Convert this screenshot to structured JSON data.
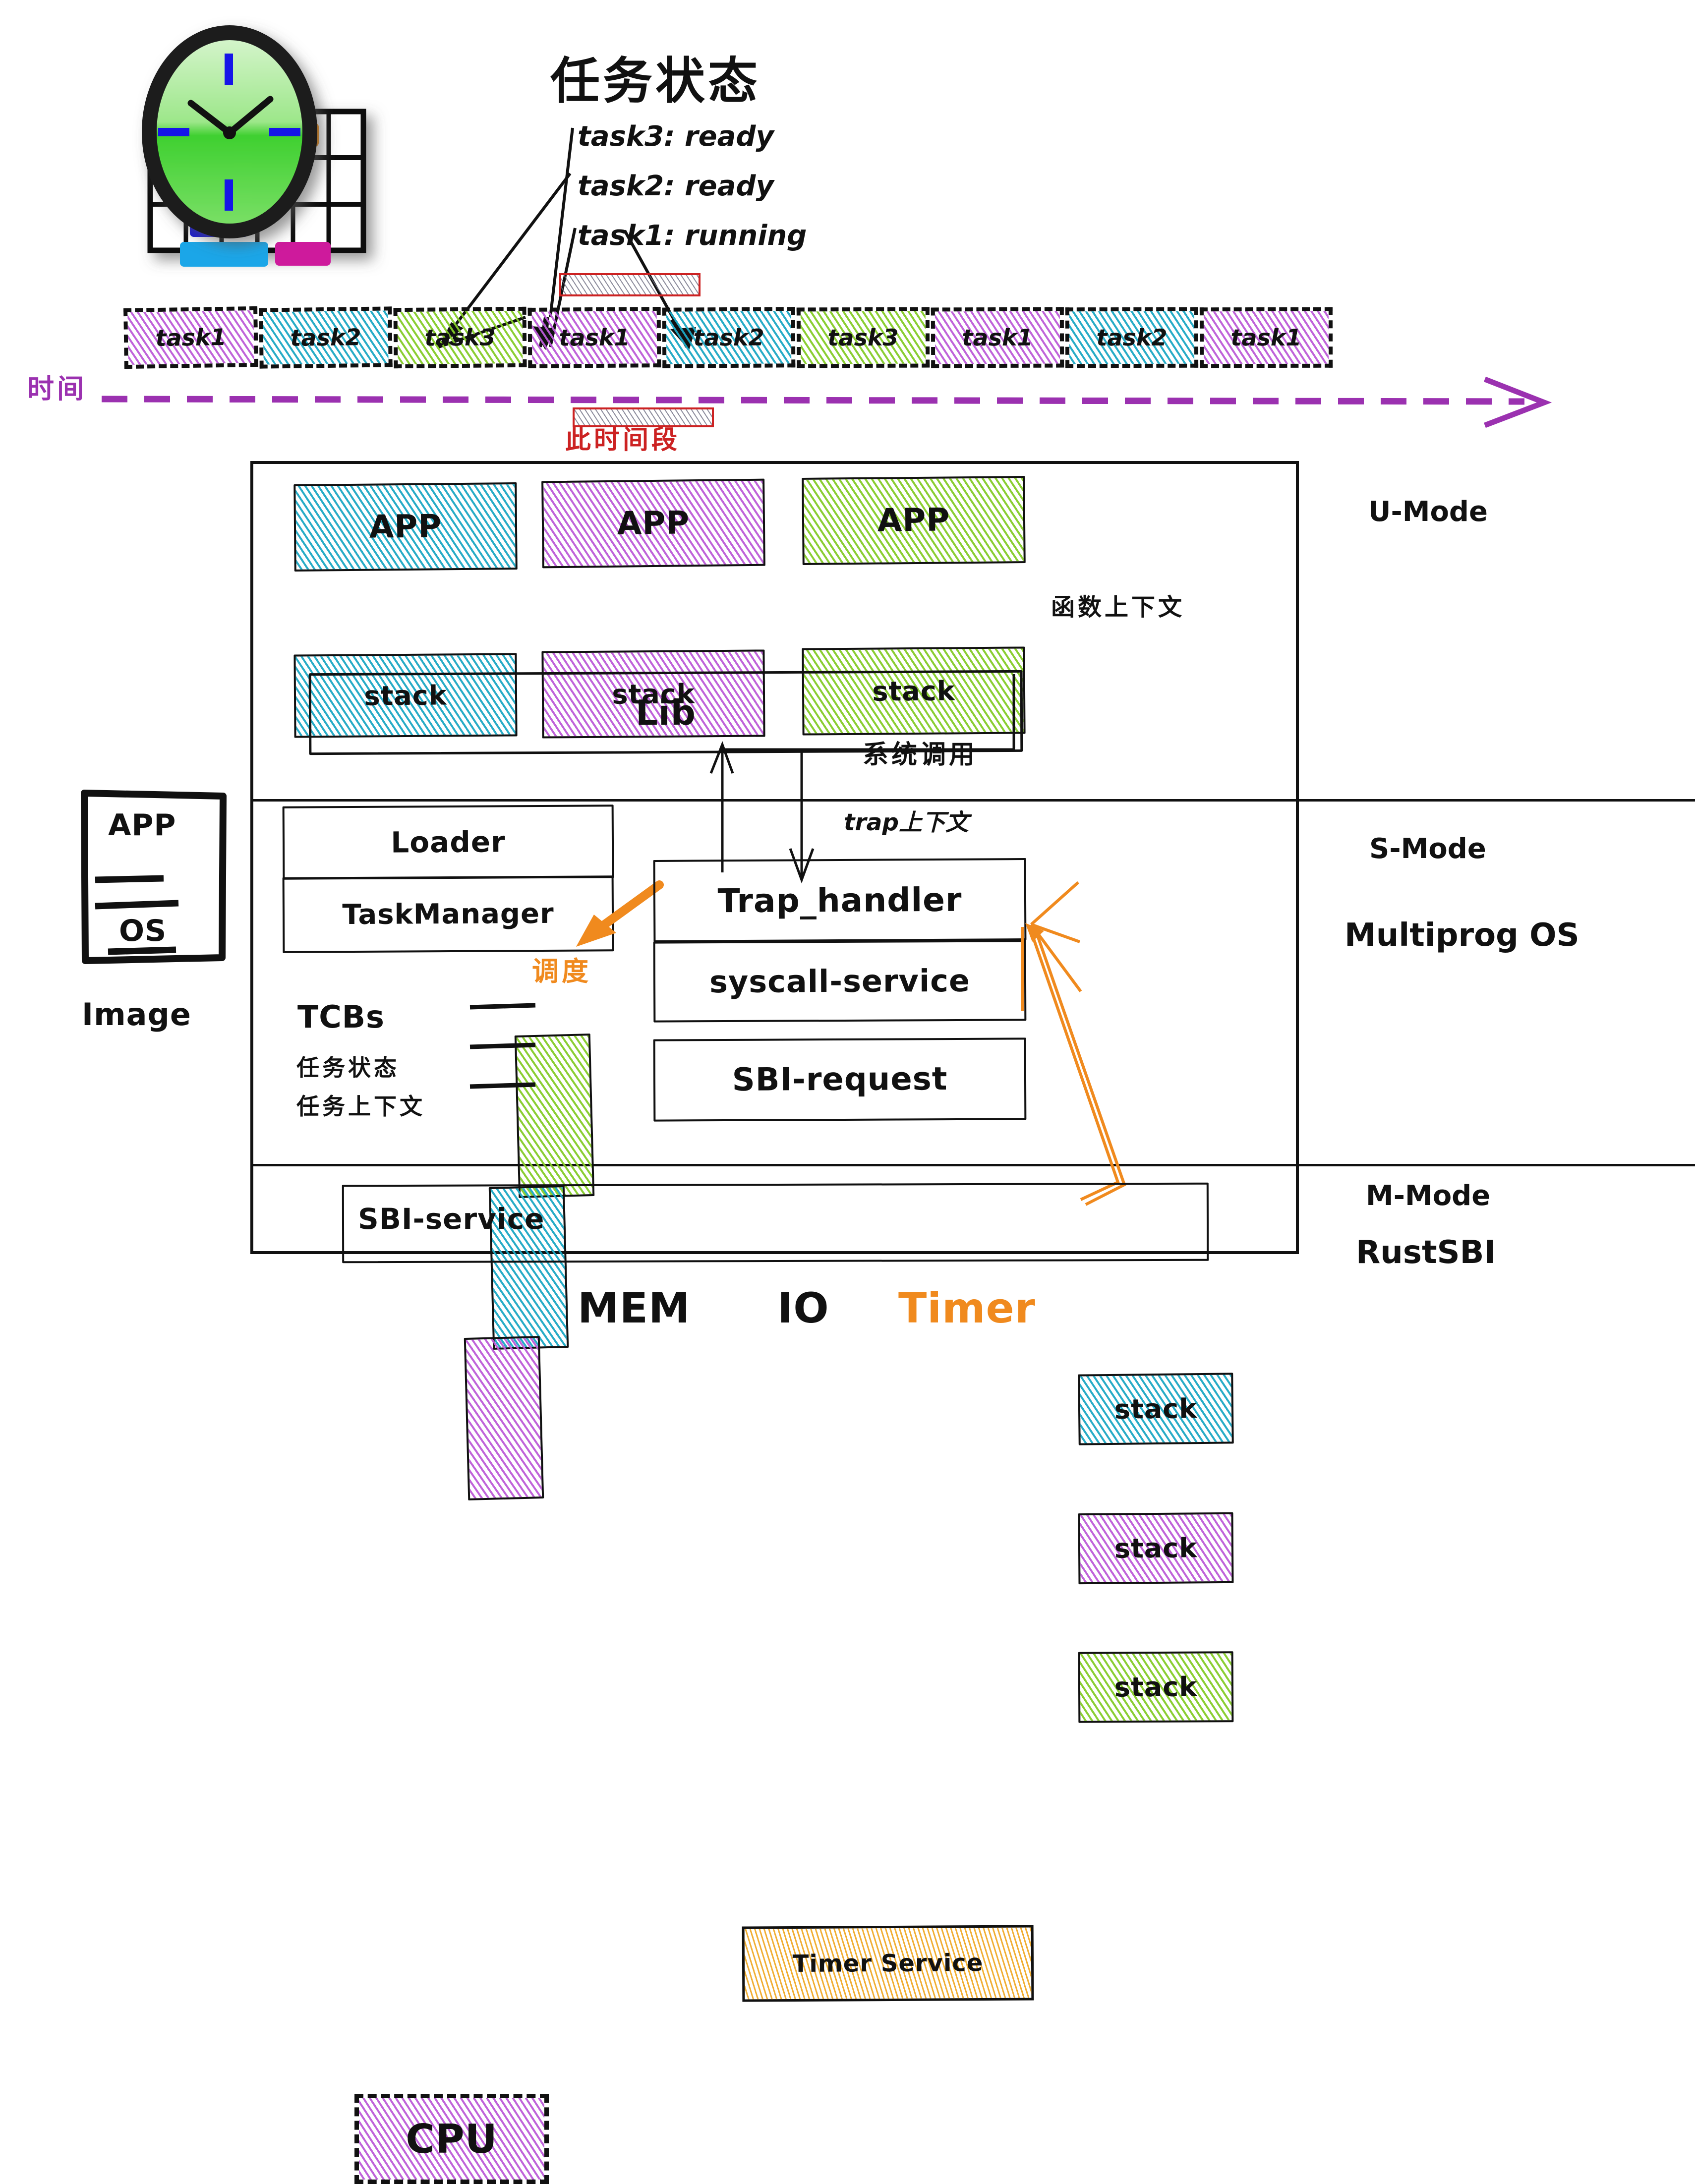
{
  "title": "任务状态",
  "task_states": [
    "task3: ready",
    "task2: ready",
    "task1: running"
  ],
  "timeline": {
    "axis_label": "时间",
    "highlight_label": "此时间段",
    "slices": [
      {
        "label": "task1",
        "color_key": "purple"
      },
      {
        "label": "task2",
        "color_key": "teal"
      },
      {
        "label": "task3",
        "color_key": "green"
      },
      {
        "label": "task1",
        "color_key": "purple"
      },
      {
        "label": "task2",
        "color_key": "teal"
      },
      {
        "label": "task3",
        "color_key": "green"
      },
      {
        "label": "task1",
        "color_key": "purple"
      },
      {
        "label": "task2",
        "color_key": "teal"
      },
      {
        "label": "task1",
        "color_key": "purple"
      }
    ]
  },
  "image_stack": {
    "app_label": "APP",
    "os_label": "OS",
    "caption": "Image"
  },
  "modes": {
    "u_mode": "U-Mode",
    "s_mode": "S-Mode",
    "s_mode_os": "Multiprog OS",
    "m_mode": "M-Mode",
    "m_mode_os": "RustSBI"
  },
  "u_mode": {
    "apps": [
      {
        "app_label": "APP",
        "stack_label": "stack",
        "color_key": "teal"
      },
      {
        "app_label": "APP",
        "stack_label": "stack",
        "color_key": "purple"
      },
      {
        "app_label": "APP",
        "stack_label": "stack",
        "color_key": "green"
      }
    ],
    "function_context_note": "函数上下文",
    "lib_label": "Lib",
    "syscall_note": "系统调用"
  },
  "s_mode": {
    "loader_label": "Loader",
    "task_manager_label": "TaskManager",
    "schedule_note": "调度",
    "tcbs_label": "TCBs",
    "tcbs_note_1": "任务状态",
    "tcbs_note_2": "任务上下文",
    "trap_handler_label": "Trap_handler",
    "syscall_service_label": "syscall-service",
    "sbi_request_label": "SBI-request",
    "trap_context_note": "trap上下文",
    "kernel_stacks": [
      {
        "label": "stack",
        "color_key": "teal"
      },
      {
        "label": "stack",
        "color_key": "purple"
      },
      {
        "label": "stack",
        "color_key": "green"
      }
    ]
  },
  "m_mode": {
    "sbi_service_label": "SBI-service",
    "timer_service_label": "Timer Service"
  },
  "hardware": {
    "cpu_label": "CPU",
    "mem_label": "MEM",
    "io_label": "IO",
    "timer_label": "Timer"
  },
  "colors": {
    "teal": "#1CA8C4",
    "purple": "#BC5BD8",
    "green": "#85CC28",
    "orange": "#F08A1E",
    "red": "#CC2222",
    "violet": "#9B31B0",
    "ink": "#111111"
  }
}
